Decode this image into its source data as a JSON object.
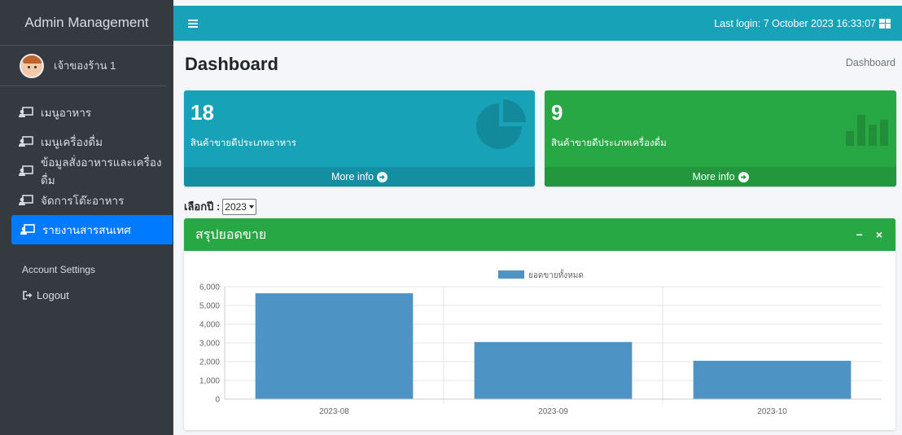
{
  "sidebar": {
    "brand": "Admin Management",
    "user_name": "เจ้าของร้าน 1",
    "items": [
      {
        "label": "เมนูอาหาร",
        "icon": "chalkboard-teacher-icon"
      },
      {
        "label": "เมนูเครื่องดื่ม",
        "icon": "chalkboard-teacher-icon"
      },
      {
        "label": "ข้อมูลสั่งอาหารและเครื่องดื่ม",
        "icon": "chalkboard-teacher-icon"
      },
      {
        "label": "จัดการโต๊ะอาหาร",
        "icon": "chalkboard-teacher-icon"
      },
      {
        "label": "รายงานสารสนเทศ",
        "icon": "chalkboard-teacher-icon",
        "active": true
      }
    ],
    "account_header": "Account Settings",
    "logout_label": "Logout"
  },
  "topbar": {
    "last_login": "Last login: 7 October 2023 16:33:07"
  },
  "page": {
    "title": "Dashboard",
    "breadcrumb": "Dashboard"
  },
  "boxes": [
    {
      "count": "18",
      "label": "สินค้าขายดีประเภทอาหาร",
      "footer": "More info",
      "icon": "pie-chart-icon",
      "color": "#17a2b8"
    },
    {
      "count": "9",
      "label": "สินค้าขายดีประเภทเครื่องดื่ม",
      "footer": "More info",
      "icon": "bar-chart-icon",
      "color": "#28a745"
    }
  ],
  "year_filter": {
    "label": "เลือกปี :",
    "selected": "2023"
  },
  "card": {
    "title": "สรุปยอดขาย",
    "minimize": "−",
    "close": "×"
  },
  "chart_data": {
    "type": "bar",
    "categories": [
      "2023-08",
      "2023-09",
      "2023-10"
    ],
    "series": [
      {
        "name": "ยอดขายทั้งหมด",
        "values": [
          5650,
          3050,
          2050
        ],
        "color": "#4d94c5"
      }
    ],
    "ylim": [
      0,
      6000
    ],
    "yticks": [
      "0",
      "1,000",
      "2,000",
      "3,000",
      "4,000",
      "5,000",
      "6,000"
    ],
    "grid": true,
    "legend": "top-center"
  }
}
